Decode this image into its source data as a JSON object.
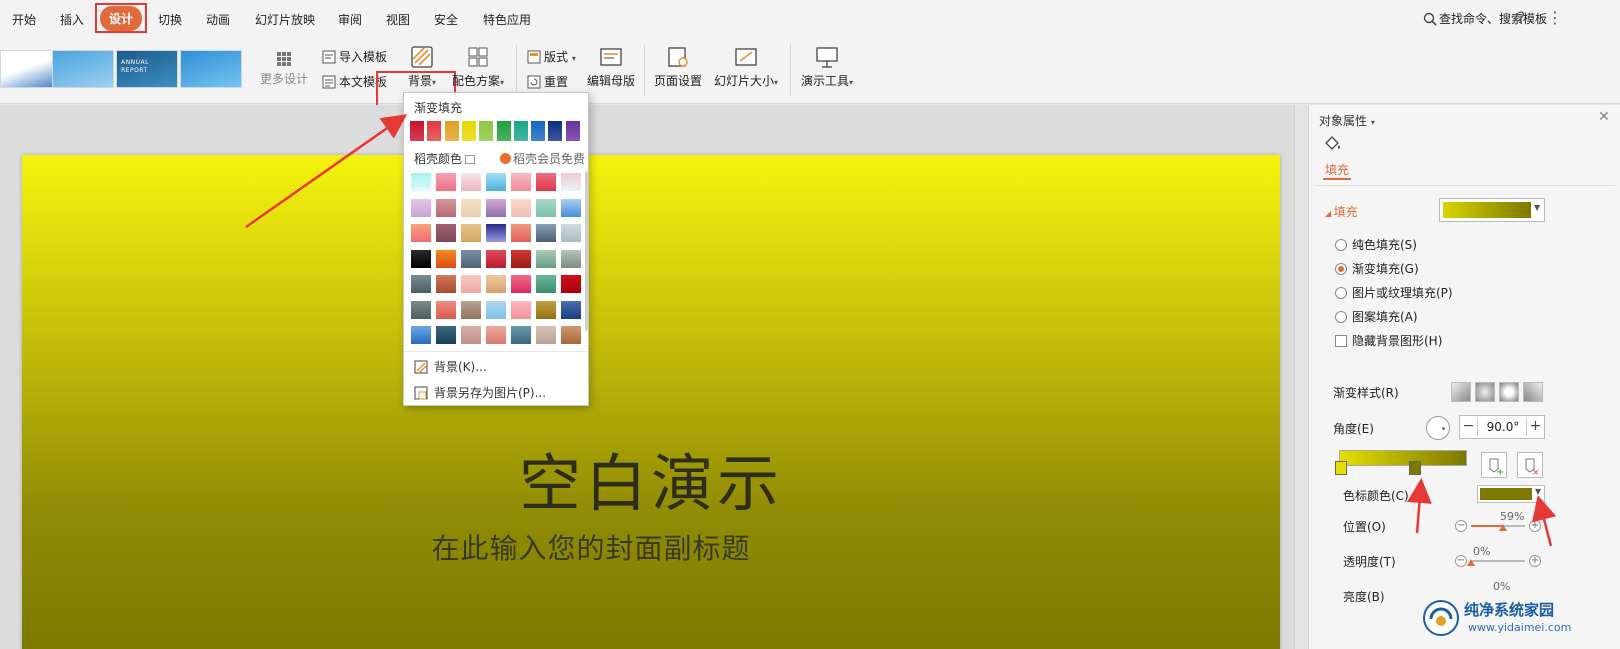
{
  "menu": {
    "items": [
      "开始",
      "插入",
      "设计",
      "切换",
      "动画",
      "幻灯片放映",
      "审阅",
      "视图",
      "安全",
      "特色应用"
    ],
    "active": "设计",
    "search": "查找命令、搜索模板",
    "help": "?",
    "more": "⋮"
  },
  "ribbon": {
    "thumbs": [
      {
        "text": "",
        "colors": [
          "#ffffff",
          "#3a78c2"
        ]
      },
      {
        "text": "",
        "colors": [
          "#4aa3df",
          "#9cd0f0"
        ]
      },
      {
        "text": "ANNUAL REPORT",
        "colors": [
          "#1e5a8a",
          "#3b8fc4"
        ]
      },
      {
        "text": "",
        "colors": [
          "#2f8fd6",
          "#74c4f0"
        ]
      }
    ],
    "more_design": "更多设计",
    "import_template": "导入模板",
    "text_template": "本文模板",
    "background": "背景",
    "color_scheme": "配色方案",
    "layout": "版式",
    "reset": "重置",
    "edit_master": "编辑母版",
    "page_setup": "页面设置",
    "slide_size": "幻灯片大小",
    "presenter_tools": "演示工具"
  },
  "dropdown": {
    "gradient_fill_header": "渐变填充",
    "gradient_swatches": [
      "#c8102e",
      "#e03a3e",
      "#e0a020",
      "#e6d800",
      "#8cc63f",
      "#1e9e3c",
      "#17a589",
      "#1565c0",
      "#0d2f80",
      "#6a2fa0"
    ],
    "docer_colors_header": "稻壳颜色",
    "docer_vip": "稻壳会员免费",
    "gradient_grid": [
      [
        "#a6f2ee,#dffafa",
        "#f5a0b0,#ec6f86",
        "#f8e4e8,#e9b6c0",
        "#a6dff5,#4bb0dc",
        "#f9b9c3,#f08a9c",
        "#f06d7d,#d93a4c",
        "#f3c7d0,#e8f6fb"
      ],
      [
        "#e8c8e6,#c6a2d8",
        "#d4959a,#b86a78",
        "#f5dfc6,#ead0b0",
        "#d4a8d0,#8c6fb2",
        "#f8d8c8,#ecc0b8",
        "#a8d8c8,#7cc0b0",
        "#a8cff0,#4a8fd8"
      ],
      [
        "#f6a47a,#f06b74",
        "#a06070,#7c4a58",
        "#e8c488,#d2a860",
        "#2a2a8c,#9a9ae0",
        "#f09a84,#e0605a",
        "#8aa0b4,#4a5e74",
        "#d0dce0,#a8bcc4"
      ],
      [
        "#2a2a2a,#000000",
        "#f28a24,#e04a12",
        "#7a8ea4,#4e647a",
        "#e04a5a,#b81c30",
        "#d03a30,#9a1a12",
        "#a8ccb8,#6a9c88",
        "#b4c4b8,#7a8c80"
      ],
      [
        "#7a8c94,#4a5c64",
        "#d07a5a,#a84a30",
        "#f6c8c0,#ecaaa0",
        "#f0c8a0,#d8a070",
        "#f06a8c,#d82a60",
        "#6ab89a,#3a8c6c",
        "#d0101a,#a8000a"
      ],
      [
        "#7a8c88,#4e5e5a",
        "#f08a80,#d85a50",
        "#b8a090,#947460",
        "#b0d8f0,#7cc0e8",
        "#f8b8c0,#f0909c",
        "#c0a040,#907010",
        "#4a70b0,#1a3a80"
      ],
      [
        "#6aa8e8,#2a6ab8",
        "#3a6880,#1a4058",
        "#d8b0a8,#c09088",
        "#f0a8a0,#d87a70",
        "#6a98a8,#3a6878",
        "#d8c0b8,#b8a090",
        "#d09a70,#a8683a"
      ]
    ],
    "background_item": "背景(K)...",
    "save_background_item": "背景另存为图片(P)..."
  },
  "slide": {
    "title": "空白演示",
    "subtitle": "在此输入您的封面副标题"
  },
  "panel": {
    "title": "对象属性",
    "tab_fill": "填充",
    "fill_section": "填充",
    "fill_options": [
      {
        "label": "纯色填充(S)",
        "selected": false
      },
      {
        "label": "渐变填充(G)",
        "selected": true
      },
      {
        "label": "图片或纹理填充(P)",
        "selected": false
      },
      {
        "label": "图案填充(A)",
        "selected": false
      }
    ],
    "hide_bg_graphics": "隐藏背景图形(H)",
    "gradient_style_label": "渐变样式(R)",
    "angle_label": "角度(E)",
    "angle_value": "90.0°",
    "stop_color_label": "色标颜色(C)",
    "stop_color": "#7c7800",
    "position_label": "位置(O)",
    "position_value": "59%",
    "position_fraction": 0.59,
    "transparency_label": "透明度(T)",
    "transparency_value": "0%",
    "transparency_fraction": 0,
    "brightness_label": "亮度(B)",
    "brightness_value": "0%"
  },
  "watermark": {
    "name": "纯净系统家园",
    "url": "www.yidaimei.com"
  },
  "colors": {
    "accent": "#e06a3c",
    "highlight_box": "#e53935"
  }
}
